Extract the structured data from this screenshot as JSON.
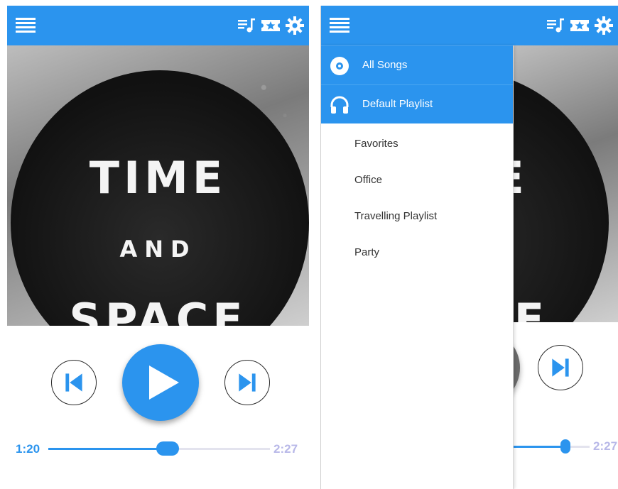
{
  "player": {
    "album_art": {
      "line1": "TIME",
      "line2": "AND",
      "line3": "SPACE"
    },
    "elapsed": "1:20",
    "duration": "2:27",
    "progress_fraction": 0.54
  },
  "drawer": {
    "header_items": [
      {
        "label": "All Songs",
        "icon": "disc-icon"
      },
      {
        "label": "Default Playlist",
        "icon": "headphones-icon"
      }
    ],
    "playlists": [
      "Favorites",
      "Office",
      "Travelling Playlist",
      "Party"
    ]
  },
  "right_player": {
    "duration": "2:27"
  },
  "icons": {
    "menu": "hamburger-menu-icon",
    "queue": "playlist-music-icon",
    "ticket": "star-ticket-icon",
    "settings": "gear-icon",
    "prev": "skip-previous-icon",
    "play": "play-icon",
    "next": "skip-next-icon"
  },
  "colors": {
    "accent": "#2b94ee",
    "elapsed_text": "#2b94ee",
    "duration_text": "#b8b8e8"
  }
}
